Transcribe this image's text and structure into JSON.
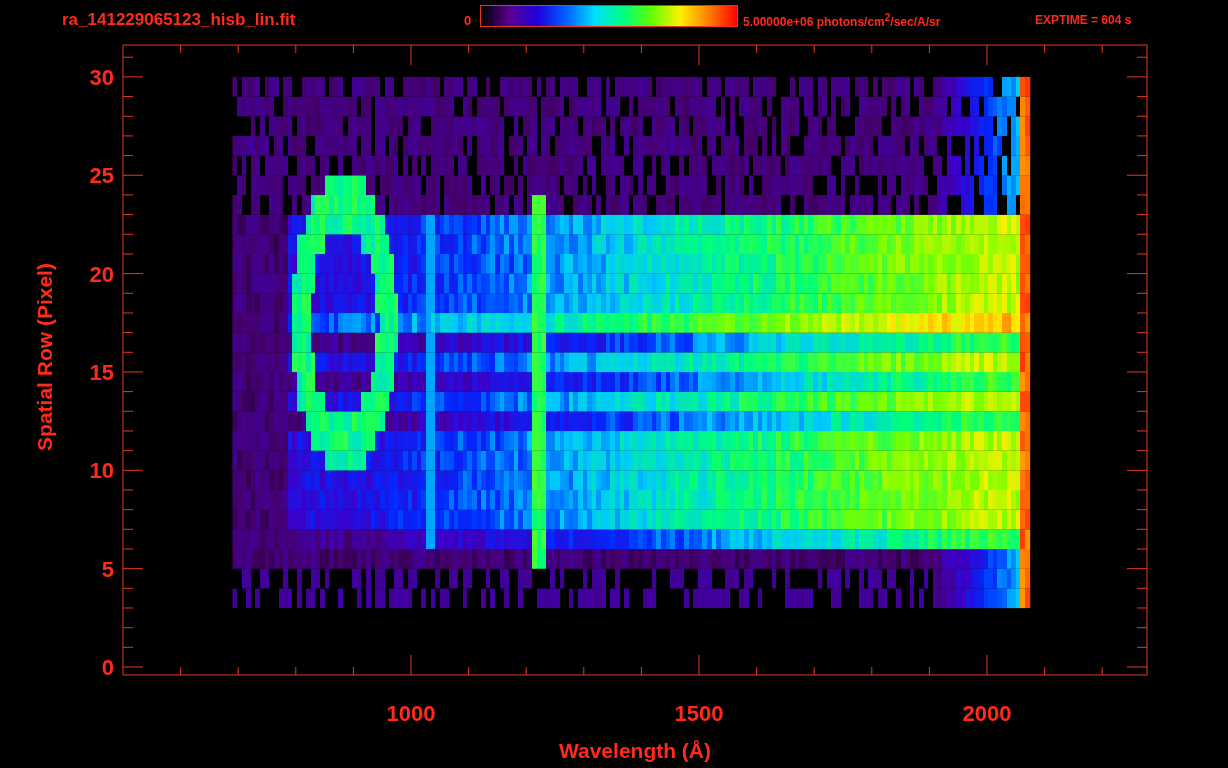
{
  "header": {
    "title": "ra_141229065123_hisb_lin.fit",
    "colorbar": {
      "min_label": "0",
      "max_label": "5.00000e+06 photons/cm$^{2}$/sec/A/sr"
    },
    "exposure": "EXPTIME = 604 s"
  },
  "plot": {
    "x_axis": {
      "label": "Wavelength (Å)",
      "ticks": [
        "1000",
        "1500",
        "2000"
      ]
    },
    "y_axis": {
      "label": "Spatial Row (Pixel)",
      "ticks": [
        "30",
        "25",
        "20",
        "15",
        "10",
        "5",
        "0"
      ]
    }
  }
}
